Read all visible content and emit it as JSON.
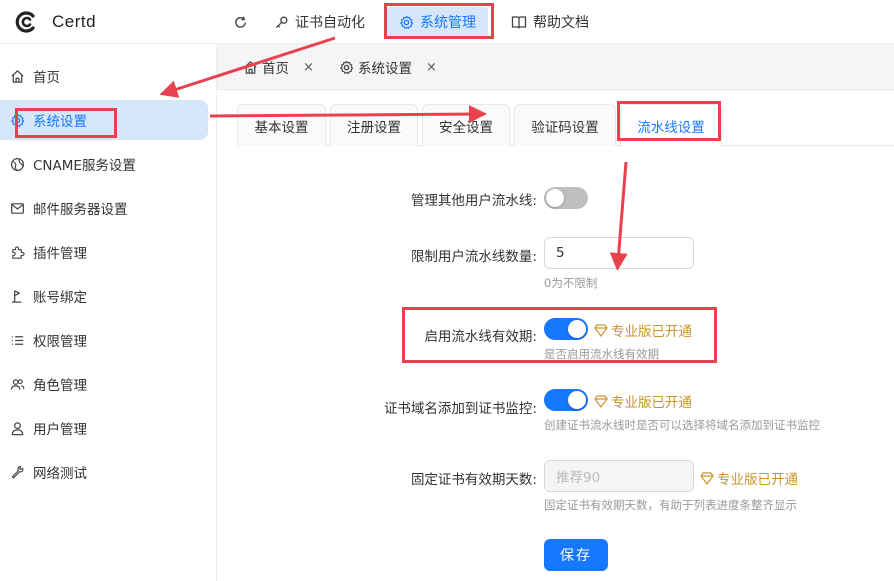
{
  "app": {
    "name": "Certd"
  },
  "top_nav": {
    "refresh_icon": "refresh-icon",
    "items": [
      {
        "label": "证书自动化",
        "icon": "key-icon"
      },
      {
        "label": "系统管理",
        "icon": "gear-icon"
      },
      {
        "label": "帮助文档",
        "icon": "book-icon"
      }
    ]
  },
  "sidebar": {
    "items": [
      {
        "label": "首页",
        "icon": "home-icon"
      },
      {
        "label": "系统设置",
        "icon": "gear-icon"
      },
      {
        "label": "CNAME服务设置",
        "icon": "globe-icon"
      },
      {
        "label": "邮件服务器设置",
        "icon": "mail-icon"
      },
      {
        "label": "插件管理",
        "icon": "puzzle-icon"
      },
      {
        "label": "账号绑定",
        "icon": "flag-icon"
      },
      {
        "label": "权限管理",
        "icon": "list-icon"
      },
      {
        "label": "角色管理",
        "icon": "users-icon"
      },
      {
        "label": "用户管理",
        "icon": "user-icon"
      },
      {
        "label": "网络测试",
        "icon": "wrench-icon"
      }
    ]
  },
  "page_tabs": [
    {
      "label": "首页",
      "close": "×"
    },
    {
      "label": "系统设置",
      "close": "×"
    }
  ],
  "settings_tabs": [
    "基本设置",
    "注册设置",
    "安全设置",
    "验证码设置",
    "流水线设置"
  ],
  "form": {
    "manage_others": {
      "label": "管理其他用户流水线:",
      "value": false
    },
    "limit_count": {
      "label": "限制用户流水线数量:",
      "value": "5",
      "help": "0为不限制"
    },
    "enable_validity": {
      "label": "启用流水线有效期:",
      "value": true,
      "pro": "专业版已开通",
      "help": "是否启用流水线有效期"
    },
    "add_monitor": {
      "label": "证书域名添加到证书监控:",
      "value": true,
      "pro": "专业版已开通",
      "help": "创建证书流水线时是否可以选择将域名添加到证书监控"
    },
    "fixed_days": {
      "label": "固定证书有效期天数:",
      "placeholder": "推荐90",
      "pro": "专业版已开通",
      "help": "固定证书有效期天数，有助于列表进度条整齐显示"
    },
    "save_label": "保存"
  },
  "colors": {
    "accent": "#1677ff",
    "active_bg": "#d6e6fb",
    "pro": "#c9962a",
    "annotation": "#e8424f"
  }
}
